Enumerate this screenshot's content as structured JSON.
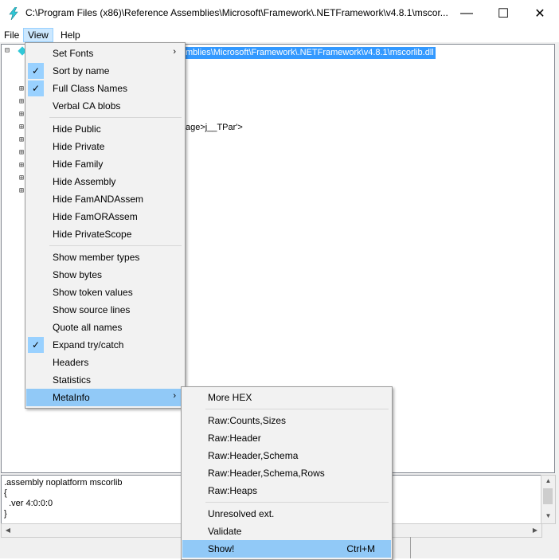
{
  "window": {
    "title": "C:\\Program Files (x86)\\Reference Assemblies\\Microsoft\\Framework\\.NETFramework\\v4.8.1\\mscor...",
    "minimize_glyph": "—",
    "maximize_glyph": "☐",
    "close_glyph": "✕"
  },
  "menubar": {
    "file": "File",
    "view": "View",
    "help": "Help"
  },
  "tree": {
    "root_path_visible": "mblies\\Microsoft\\Framework\\.NETFramework\\v4.8.1\\mscorlib.dll",
    "partial_node_text": "age>j__TPar'>",
    "expander_glyph": "⊞",
    "root_expander_glyph": "⊟"
  },
  "disasm": {
    "lines": [
      ".assembly noplatform mscorlib",
      "{",
      "  .ver 4:0:0:0",
      "}"
    ]
  },
  "view_menu": {
    "items": [
      {
        "label": "Set Fonts",
        "checked": false,
        "submenu": true
      },
      {
        "label": "Sort by name",
        "checked": true
      },
      {
        "label": "Full Class Names",
        "checked": true
      },
      {
        "label": "Verbal CA blobs",
        "checked": false
      },
      {
        "label": "Hide Public",
        "checked": false
      },
      {
        "label": "Hide Private",
        "checked": false
      },
      {
        "label": "Hide Family",
        "checked": false
      },
      {
        "label": "Hide Assembly",
        "checked": false
      },
      {
        "label": "Hide FamANDAssem",
        "checked": false
      },
      {
        "label": "Hide FamORAssem",
        "checked": false
      },
      {
        "label": "Hide PrivateScope",
        "checked": false
      },
      {
        "label": "Show member types",
        "checked": false
      },
      {
        "label": "Show bytes",
        "checked": false
      },
      {
        "label": "Show token values",
        "checked": false
      },
      {
        "label": "Show source lines",
        "checked": false
      },
      {
        "label": "Quote all names",
        "checked": false
      },
      {
        "label": "Expand try/catch",
        "checked": true
      },
      {
        "label": "Headers",
        "checked": false
      },
      {
        "label": "Statistics",
        "checked": false
      },
      {
        "label": "MetaInfo",
        "checked": false,
        "submenu": true,
        "highlighted": true
      }
    ],
    "check_glyph": "✓",
    "arrow_glyph": "›"
  },
  "metainfo_menu": {
    "items": [
      {
        "label": "More HEX"
      },
      {
        "label": "Raw:Counts,Sizes"
      },
      {
        "label": "Raw:Header"
      },
      {
        "label": "Raw:Header,Schema"
      },
      {
        "label": "Raw:Header,Schema,Rows"
      },
      {
        "label": "Raw:Heaps"
      },
      {
        "label": "Unresolved ext."
      },
      {
        "label": "Validate"
      },
      {
        "label": "Show!",
        "accelerator": "Ctrl+M",
        "highlighted": true
      }
    ]
  },
  "colors": {
    "selection": "#3399ff",
    "menu_highlight": "#91c9f7",
    "check_bg": "#99d1ff",
    "icon_accent": "#30c8d8"
  }
}
